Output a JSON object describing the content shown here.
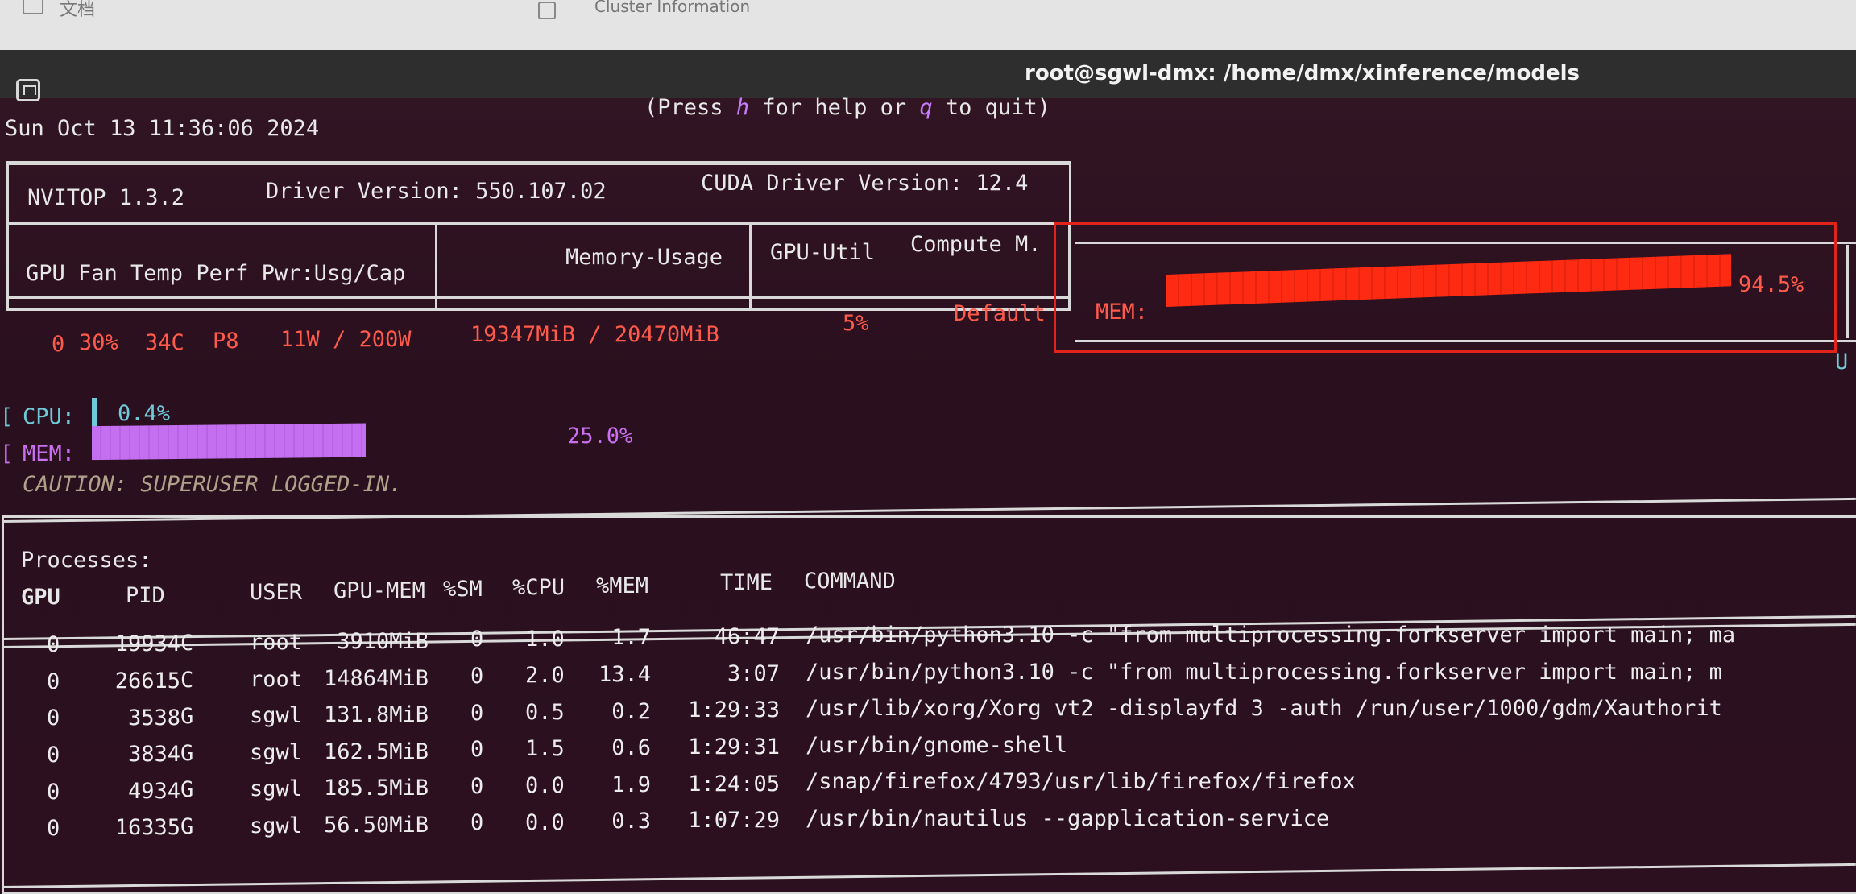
{
  "desktop": {
    "item1": "文档",
    "item2": "Cluster Information"
  },
  "window": {
    "title": "root@sgwl-dmx: /home/dmx/xinference/models"
  },
  "header": {
    "help_prefix": "(Press ",
    "help_key": "h",
    "help_mid": " for help or ",
    "quit_key": "q",
    "help_suffix": " to quit)",
    "datetime": "Sun Oct 13 11:36:06 2024"
  },
  "gpu_table": {
    "nvitop": "NVITOP 1.3.2",
    "driver": "Driver Version: 550.107.02",
    "cuda": "CUDA Driver Version: 12.4",
    "col_main": "GPU Fan Temp Perf Pwr:Usg/Cap",
    "col_mem": "Memory-Usage",
    "col_util": "GPU-Util",
    "col_compute": "Compute M.",
    "gpu_row": {
      "gpu": "0",
      "fan": "30%",
      "temp": "34C",
      "perf": "P8",
      "power": "11W / 200W",
      "memory": "19347MiB / 20470MiB",
      "util": "5%",
      "compute": "Default"
    },
    "mem_label": "MEM:",
    "mem_percent": "94.5%",
    "mem_fraction": 0.945,
    "cut_off_text": "U"
  },
  "host": {
    "cpu_label": "CPU:",
    "cpu_value": "0.4%",
    "cpu_fraction": 0.004,
    "mem_label": "MEM:",
    "mem_value": "25.0%",
    "mem_fraction": 0.25,
    "caution": "CAUTION: SUPERUSER LOGGED-IN."
  },
  "processes": {
    "title": "Processes:",
    "headers": {
      "gpu": "GPU",
      "pid": "PID",
      "user": "USER",
      "gpumem": "GPU-MEM",
      "sm": "%SM",
      "cpu": "%CPU",
      "mem": "%MEM",
      "time": "TIME",
      "command": "COMMAND"
    },
    "rows": [
      {
        "gpu": "0",
        "pid": "19934",
        "type": "C",
        "user": "root",
        "gpumem": "3910MiB",
        "sm": "0",
        "cpu": "1.0",
        "mem": "1.7",
        "time": "46:47",
        "command": "/usr/bin/python3.10 -c \"from multiprocessing.forkserver import main; ma"
      },
      {
        "gpu": "0",
        "pid": "26615",
        "type": "C",
        "user": "root",
        "gpumem": "14864MiB",
        "sm": "0",
        "cpu": "2.0",
        "mem": "13.4",
        "time": "3:07",
        "command": "/usr/bin/python3.10 -c \"from multiprocessing.forkserver import main; m"
      },
      {
        "gpu": "0",
        "pid": "3538",
        "type": "G",
        "user": "sgwl",
        "gpumem": "131.8MiB",
        "sm": "0",
        "cpu": "0.5",
        "mem": "0.2",
        "time": "1:29:33",
        "command": "/usr/lib/xorg/Xorg vt2 -displayfd 3 -auth /run/user/1000/gdm/Xauthorit"
      },
      {
        "gpu": "0",
        "pid": "3834",
        "type": "G",
        "user": "sgwl",
        "gpumem": "162.5MiB",
        "sm": "0",
        "cpu": "1.5",
        "mem": "0.6",
        "time": "1:29:31",
        "command": "/usr/bin/gnome-shell"
      },
      {
        "gpu": "0",
        "pid": "4934",
        "type": "G",
        "user": "sgwl",
        "gpumem": "185.5MiB",
        "sm": "0",
        "cpu": "0.0",
        "mem": "1.9",
        "time": "1:24:05",
        "command": "/snap/firefox/4793/usr/lib/firefox/firefox"
      },
      {
        "gpu": "0",
        "pid": "16335",
        "type": "G",
        "user": "sgwl",
        "gpumem": "56.50MiB",
        "sm": "0",
        "cpu": "0.0",
        "mem": "0.3",
        "time": "1:07:29",
        "command": "/usr/bin/nautilus --gapplication-service"
      }
    ]
  },
  "colors": {
    "accent_red": "#ff5a4a",
    "cpu_cyan": "#6ecad8",
    "mem_purple": "#c96ff0",
    "highlight_frame": "#e2231a"
  }
}
